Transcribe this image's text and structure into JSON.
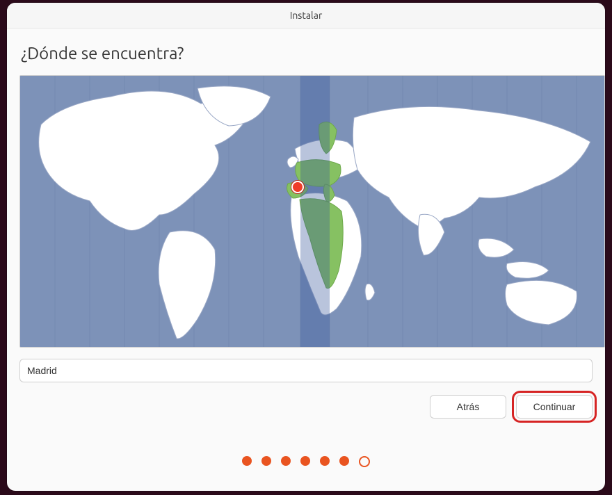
{
  "window": {
    "title": "Instalar"
  },
  "heading": "¿Dónde se encuentra?",
  "location": {
    "value": "Madrid"
  },
  "buttons": {
    "back": "Atrás",
    "continue": "Continuar"
  },
  "progress": {
    "total": 7,
    "current": 6
  },
  "map": {
    "selected_timezone_band": {
      "left_pct": 48.0,
      "width_pct": 5.0
    },
    "pin": {
      "x_pct": 47.5,
      "y_pct": 41.0,
      "label": "Madrid"
    },
    "colors": {
      "ocean": "#7d92b8",
      "land": "#ffffff",
      "land_border": "#9aa8c6",
      "highlight": "#86c162",
      "highlight_border": "#6fa94c"
    },
    "tz_grid_lines_pct": [
      6,
      12,
      18,
      24,
      30,
      36,
      42,
      48,
      54,
      60,
      66,
      72,
      78,
      84,
      90,
      96
    ]
  },
  "callout": {
    "around": "continue-button"
  }
}
